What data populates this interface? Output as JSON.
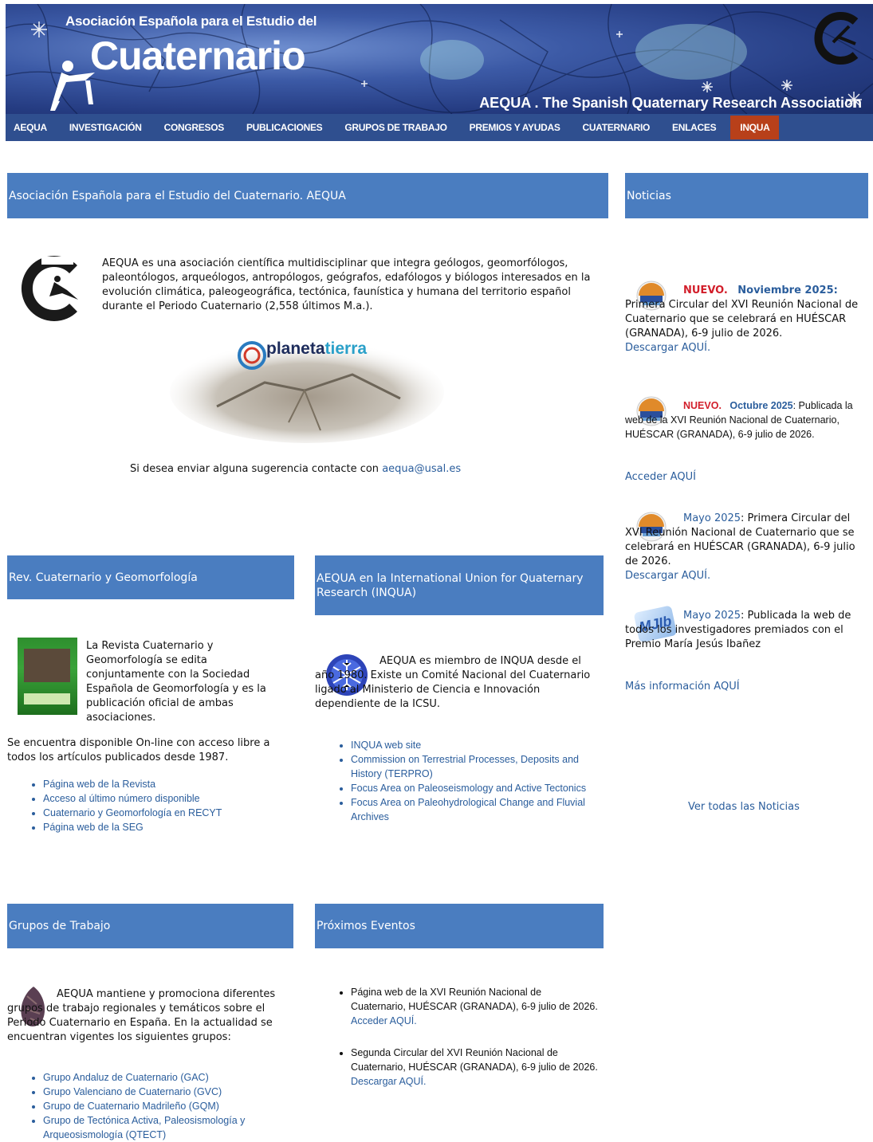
{
  "header": {
    "org_top": "Asociación Española para el Estudio del",
    "org_main": "Cuaternario",
    "org_sub": "AEQUA . The Spanish Quaternary Research Association",
    "logo_icon": "aequa-logo-icon"
  },
  "nav": {
    "items": [
      "AEQUA",
      "INVESTIGACIÓN",
      "CONGRESOS",
      "PUBLICACIONES",
      "GRUPOS DE TRABAJO",
      "PREMIOS Y AYUDAS",
      "CUATERNARIO",
      "ENLACES",
      "INQUA"
    ],
    "active": "INQUA"
  },
  "main": {
    "title": "Asociación Española para el Estudio del Cuaternario. AEQUA",
    "intro": "AEQUA es una asociación científica multidisciplinar que integra geólogos, geomorfólogos, paleontólogos, arqueólogos, antropólogos, geógrafos, edafólogos y biólogos interesados en la evolución climática, paleogeográfica, tectónica, faunística y humana del territorio español durante el Periodo Cuaternario (2,558 últimos M.a.).",
    "planeta_brand1": "planeta",
    "planeta_brand2": "tierra",
    "contact_text": "Si desea enviar alguna sugerencia contacte con ",
    "contact_email": "aequa@usal.es"
  },
  "revista": {
    "title": "Rev. Cuaternario y Geomorfología",
    "text1": "La Revista Cuaternario y Geomorfología se edita conjuntamente con la Sociedad Española  de Geomorfología y es la publicación oficial  de ambas asociaciones.",
    "text2": "Se encuentra disponible On-line con acceso libre a todos los artículos publicados desde 1987.",
    "links": [
      "Página web de la Revista",
      "Acceso al último número disponible",
      "Cuaternario y Geomorfología en RECYT",
      "Página web de la SEG"
    ]
  },
  "inqua": {
    "title": "AEQUA en la International Union for Quaternary Research (INQUA)",
    "text": "AEQUA es miembro de INQUA desde el año 1980. Existe un Comité Nacional del Cuaternario ligado al Ministerio de Ciencia e Innovación dependiente de la ICSU.",
    "links": [
      "INQUA web site",
      "Commission on Terrestrial Processes, Deposits and History (TERPRO)",
      "Focus Area on Paleoseismology and Active Tectonics",
      "Focus Area on Paleohydrological Change and Fluvial Archives"
    ]
  },
  "grupos": {
    "title": "Grupos de Trabajo",
    "text": "AEQUA mantiene y promociona diferentes grupos de trabajo regionales y temáticos sobre el Periodo Cuaternario en España. En la actualidad se encuentran vigentes los siguientes grupos:",
    "links": [
      "Grupo Andaluz de Cuaternario (GAC)",
      "Grupo Valenciano de Cuaternario (GVC)",
      "Grupo de Cuaternario Madrileño (GQM)",
      "Grupo de Tectónica Activa, Paleosismología y Arqueosismología (QTECT)"
    ]
  },
  "eventos": {
    "title": "Próximos Eventos",
    "items": [
      {
        "text": "Página web de la XVI Reunión Nacional de Cuaternario, HUÉSCAR (GRANADA), 6-9 julio de 2026.",
        "link": "Acceder AQUÍ."
      },
      {
        "text": "Segunda Circular del XVI Reunión Nacional de Cuaternario, HUÉSCAR (GRANADA), 6-9 julio de 2026.",
        "link": "Descargar AQUÍ."
      }
    ]
  },
  "noticias": {
    "title": "Noticias",
    "n1": {
      "tag": "NUEVO.",
      "date": "Noviembre 2025:",
      "text": "Primera Circular del XVI Reunión Nacional de Cuaternario que se celebrará en HUÉSCAR (GRANADA), 6-9 julio de 2026.",
      "link": "Descargar AQUÍ."
    },
    "n2": {
      "tag": "NUEVO.",
      "date": "Octubre 2025",
      "text": ": Publicada la web de la XVI Reunión Nacional de Cuaternario, HUÉSCAR (GRANADA), 6-9 julio de 2026.",
      "link": "Acceder AQUÍ"
    },
    "n3": {
      "date": "Mayo 2025",
      "text": ": Primera Circular del XVI Reunión Nacional de Cuaternario que se celebrará en HUÉSCAR (GRANADA), 6-9 julio de 2026.",
      "link": "Descargar AQUÍ."
    },
    "n4": {
      "date": "Mayo 2025",
      "text": ": Publicada la web de todos los investigadores premiados con el Premio María Jesús Ibañez",
      "link": "Más información AQUÍ",
      "badge": "MJIb"
    },
    "all_link": "Ver todas las Noticias"
  }
}
